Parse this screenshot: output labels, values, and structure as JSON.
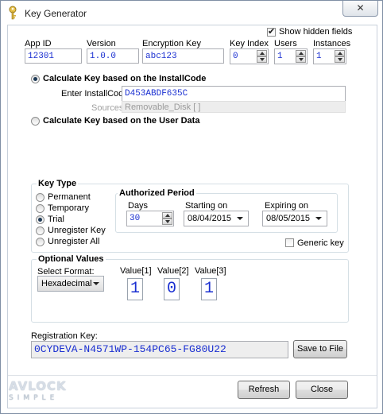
{
  "window": {
    "title": "Key Generator",
    "close_glyph": "✕"
  },
  "show_hidden_fields": {
    "label": "Show hidden fields",
    "checked": true
  },
  "fields": {
    "app_id": {
      "label": "App ID",
      "value": "12301"
    },
    "version": {
      "label": "Version",
      "value": "1.0.0"
    },
    "encryption_key": {
      "label": "Encryption Key",
      "value": "abc123"
    },
    "key_index": {
      "label": "Key Index",
      "value": "0"
    },
    "users": {
      "label": "Users",
      "value": "1"
    },
    "instances": {
      "label": "Instances",
      "value": "1"
    }
  },
  "install_code_option": {
    "label": "Calculate Key based on the InstallCode",
    "selected": true,
    "enter_label": "Enter InstallCode:",
    "value": "D453ABDF635C",
    "sources_label": "Sources:",
    "sources_value": "Removable_Disk [ ]"
  },
  "user_data_option": {
    "label": "Calculate Key based on the User Data",
    "selected": false
  },
  "key_type": {
    "title": "Key Type",
    "options": [
      "Permanent",
      "Temporary",
      "Trial",
      "Unregister Key",
      "Unregister All"
    ],
    "selected": "Trial"
  },
  "authorized_period": {
    "title": "Authorized Period",
    "days_label": "Days",
    "days_value": "30",
    "starting_label": "Starting on",
    "starting_value": "08/04/2015",
    "expiring_label": "Expiring on",
    "expiring_value": "08/05/2015"
  },
  "generic_key": {
    "label": "Generic key",
    "checked": false
  },
  "optional_values": {
    "title": "Optional Values",
    "format_label": "Select Format:",
    "format_value": "Hexadecimal",
    "values": [
      {
        "label": "Value[1]",
        "value": "1"
      },
      {
        "label": "Value[2]",
        "value": "0"
      },
      {
        "label": "Value[3]",
        "value": "1"
      }
    ]
  },
  "registration": {
    "label": "Registration Key:",
    "value": "0CYDEVA-N4571WP-154PC65-FG80U22",
    "save_button": "Save to File"
  },
  "buttons": {
    "refresh": "Refresh",
    "close": "Close"
  },
  "logo": {
    "line1": "AVLOCK",
    "line2": "SIMPLE"
  },
  "colors": {
    "value_text": "#1a2fd1",
    "border": "#abadb3"
  }
}
